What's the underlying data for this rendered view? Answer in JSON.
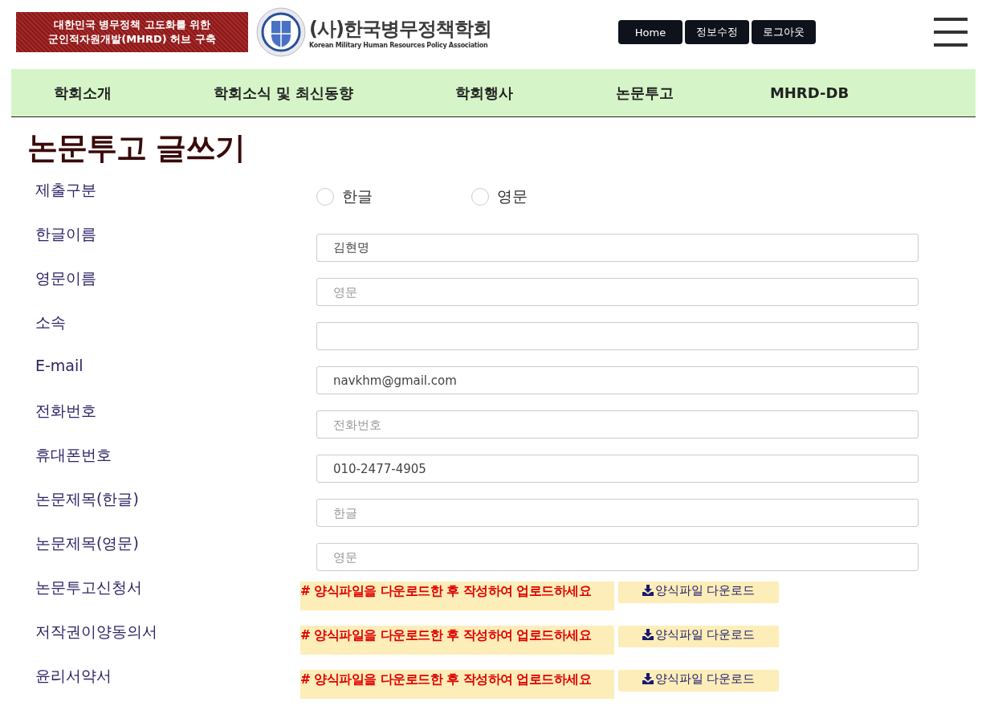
{
  "banner": {
    "lines": [
      "대한민국 병무정책 고도화를 위한",
      "군인적자원개발(MHRD) 허브 구축"
    ]
  },
  "logo": {
    "title": "(사)한국병무정책학회",
    "subtitle": "Korean Military Human Resources Policy Association"
  },
  "top_buttons": [
    "Home",
    "정보수정",
    "로그아웃"
  ],
  "nav": [
    "학회소개",
    "학회소식 및 최신동향",
    "학회행사",
    "논문투고",
    "MHRD-DB"
  ],
  "page_title": "논문투고 글쓰기",
  "form": [
    {
      "kind": "radio",
      "label": "제출구분",
      "options": [
        {
          "label": "한글",
          "selected": false
        },
        {
          "label": "영문",
          "selected": false
        }
      ]
    },
    {
      "kind": "text",
      "label": "한글이름",
      "value": "김현명"
    },
    {
      "kind": "text",
      "label": "영문이름",
      "placeholder": "영문"
    },
    {
      "kind": "text",
      "label": "소속"
    },
    {
      "kind": "text",
      "label": "E-mail",
      "value": "navkhm@gmail.com"
    },
    {
      "kind": "text",
      "label": "전화번호",
      "placeholder": "전화번호"
    },
    {
      "kind": "text",
      "label": "휴대폰번호",
      "value": "010-2477-4905"
    },
    {
      "kind": "text",
      "label": "논문제목(한글)",
      "placeholder": "한글"
    },
    {
      "kind": "text",
      "label": "논문제목(영문)",
      "placeholder": "영문"
    },
    {
      "kind": "upload",
      "label": "논문투고신청서",
      "notice": "# 양식파일을 다운로드한 후 작성하여 업로드하세요",
      "button": "양식파일 다운로드"
    },
    {
      "kind": "upload",
      "label": "저작권이양동의서",
      "notice": "# 양식파일을 다운로드한 후 작성하여 업로드하세요",
      "button": "양식파일 다운로드"
    },
    {
      "kind": "upload",
      "label": "윤리서약서",
      "notice": "# 양식파일을 다운로드한 후 작성하여 업로드하세요",
      "button": "양식파일 다운로드"
    }
  ]
}
